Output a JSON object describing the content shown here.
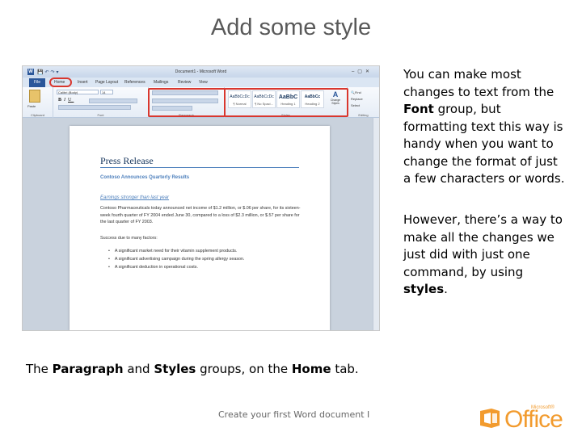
{
  "slide": {
    "title": "Add some style",
    "side_text_1_parts": [
      "You can make most changes to text from the ",
      "Font",
      " group, but formatting text this way is handy when you want to change the format of just a few characters or words."
    ],
    "side_text_2_parts": [
      "However, there’s a way to make all the changes we just did with just one command, by using ",
      "styles",
      "."
    ],
    "caption_parts": [
      "The ",
      "Paragraph",
      " and ",
      "Styles",
      " groups, on the ",
      "Home",
      " tab."
    ],
    "footer": "Create your first Word document I",
    "logo": {
      "brand": "Office",
      "vendor": "Microsoft®"
    }
  },
  "word": {
    "window_title": "Document1 - Microsoft Word",
    "tabs": [
      "File",
      "Home",
      "Insert",
      "Page Layout",
      "References",
      "Mailings",
      "Review",
      "View"
    ],
    "ribbon": {
      "clipboard": {
        "label": "Clipboard",
        "paste": "Paste"
      },
      "font": {
        "label": "Font",
        "name": "Calibri (Body)",
        "size": "14"
      },
      "paragraph": {
        "label": "Paragraph"
      },
      "styles": {
        "label": "Styles",
        "items": [
          {
            "sample": "AaBbCcDc",
            "name": "¶ Normal"
          },
          {
            "sample": "AaBbCcDc",
            "name": "¶ No Spaci..."
          },
          {
            "sample": "AaBbC",
            "name": "Heading 1"
          },
          {
            "sample": "AaBbCc",
            "name": "Heading 2"
          }
        ],
        "change_styles": "Change Styles"
      },
      "editing": {
        "label": "Editing",
        "find": "Find",
        "replace": "Replace",
        "select": "Select"
      }
    },
    "document": {
      "title": "Press Release",
      "subtitle": "Contoso Announces Quarterly Results",
      "heading": "Earnings stronger than last year",
      "paragraph": "Contoso Pharmaceuticals today announced net income of $1.2 million, or $.06 per share, for its sixteen-week fourth quarter of FY 2004 ended June 30, compared to a loss of $2.3 million, or $.57 per share for the last quarter of FY 2003.",
      "list_intro": "Success due to many factors:",
      "bullets": [
        "A significant market need for their vitamin supplement products.",
        "A significant advertising campaign during the spring allergy season.",
        "A significant deduction in operational costs."
      ]
    }
  },
  "colors": {
    "highlight": "#d9372e",
    "office_orange": "#f29b2e",
    "word_blue": "#2b579a",
    "heading_blue": "#4f81bd"
  }
}
